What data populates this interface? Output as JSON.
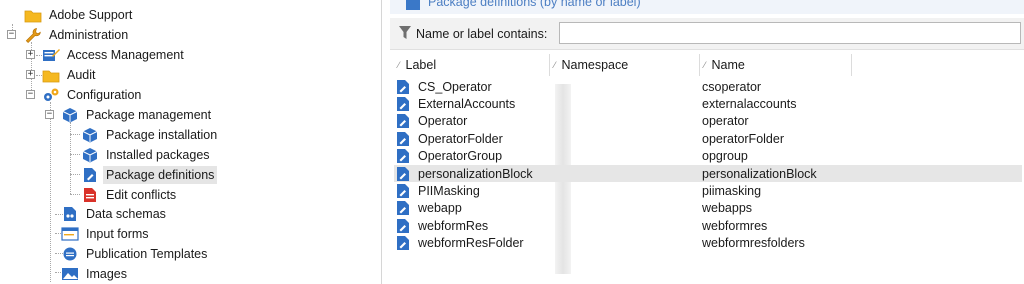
{
  "tree": {
    "items": [
      {
        "label": "Adobe Support",
        "icon": "folder-icon"
      },
      {
        "label": "Administration",
        "icon": "wrench-icon"
      },
      {
        "label": "Access Management",
        "icon": "access-management-icon"
      },
      {
        "label": "Audit",
        "icon": "folder-icon"
      },
      {
        "label": "Configuration",
        "icon": "gears-icon"
      },
      {
        "label": "Package management",
        "icon": "package-icon"
      },
      {
        "label": "Package installation",
        "icon": "package-icon"
      },
      {
        "label": "Installed packages",
        "icon": "package-icon"
      },
      {
        "label": "Package definitions",
        "icon": "package-definition-icon"
      },
      {
        "label": "Edit conflicts",
        "icon": "conflict-document-icon"
      },
      {
        "label": "Data schemas",
        "icon": "schema-document-icon"
      },
      {
        "label": "Input forms",
        "icon": "form-window-icon"
      },
      {
        "label": "Publication Templates",
        "icon": "publication-template-icon"
      },
      {
        "label": "Images",
        "icon": "image-icon"
      }
    ]
  },
  "header": {
    "title": "Package definitions (by name or label)"
  },
  "filter": {
    "label": "Name or label contains:",
    "value": ""
  },
  "grid": {
    "columns": [
      "Label",
      "Namespace",
      "Name"
    ],
    "rows": [
      {
        "label": "CS_Operator",
        "name": "csoperator"
      },
      {
        "label": "ExternalAccounts",
        "name": "externalaccounts"
      },
      {
        "label": "Operator",
        "name": "operator"
      },
      {
        "label": "OperatorFolder",
        "name": "operatorFolder"
      },
      {
        "label": "OperatorGroup",
        "name": "opgroup"
      },
      {
        "label": "personalizationBlock",
        "name": "personalizationBlock"
      },
      {
        "label": "PIIMasking",
        "name": "piimasking"
      },
      {
        "label": "webapp",
        "name": "webapps"
      },
      {
        "label": "webformRes",
        "name": "webformres"
      },
      {
        "label": "webformResFolder",
        "name": "webformresfolders"
      }
    ]
  },
  "colors": {
    "folder": "#f5b820",
    "accent_blue": "#2f6fc4",
    "conflict_red": "#d9322a",
    "selected_bg": "#e5e5e5"
  }
}
